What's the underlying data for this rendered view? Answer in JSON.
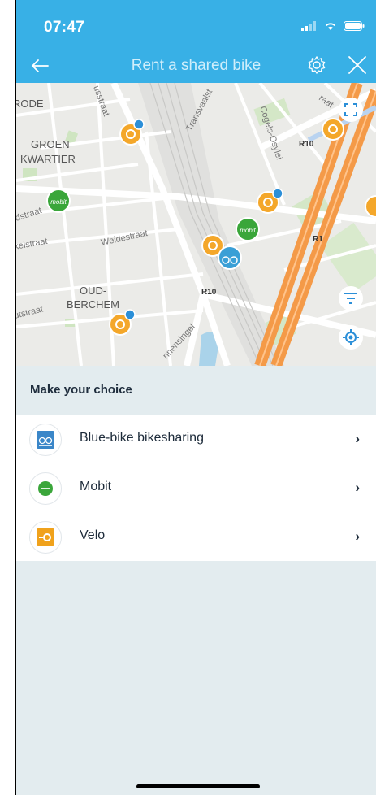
{
  "status": {
    "time": "07:47"
  },
  "nav": {
    "title": "Rent a shared bike"
  },
  "map": {
    "labels": {
      "rode": "RODE",
      "groen": "GROEN",
      "kwartier": "KWARTIER",
      "ussstraat": "usstraat",
      "transvaal": "Transvaalst",
      "cogels": "Cogels-Osylei",
      "r10_top": "R10",
      "dstraat": "dstraat",
      "kelstraat": "kelstraat",
      "weidestraat": "Weidestraat",
      "r1": "R1",
      "oud": "OUD-",
      "berchem": "BERCHEM",
      "r10_mid": "R10",
      "utstraat": "utstraat",
      "singel": "nnensingel",
      "aat": "raat"
    },
    "marker_text": {
      "mobit": "mobit"
    }
  },
  "choice": {
    "title": "Make your choice"
  },
  "options": [
    {
      "label": "Blue-bike bikesharing",
      "icon": "blue-bike-icon"
    },
    {
      "label": "Mobit",
      "icon": "mobit-icon"
    },
    {
      "label": "Velo",
      "icon": "velo-icon"
    }
  ],
  "colors": {
    "header": "#38b0e6",
    "velo": "#f0a21c",
    "mobit": "#3aa63a",
    "bluebike": "#3a9fd6"
  }
}
